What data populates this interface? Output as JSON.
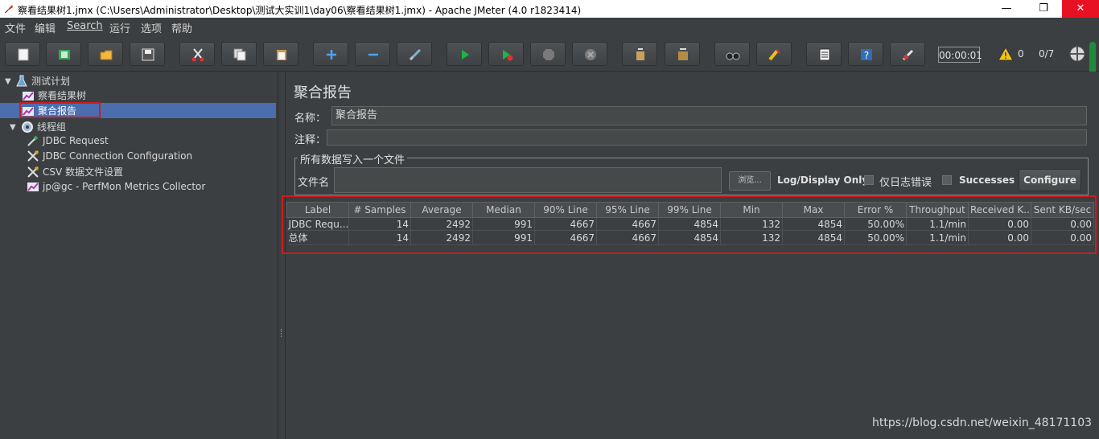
{
  "window": {
    "title": "察看结果树1.jmx (C:\\Users\\Administrator\\Desktop\\测试大实训1\\day06\\察看结果树1.jmx) - Apache JMeter (4.0 r1823414)",
    "minimize": "—",
    "maximize": "❐",
    "close": "✕"
  },
  "menu": [
    "文件",
    "编辑",
    "Search",
    "运行",
    "选项",
    "帮助"
  ],
  "toolbar": {
    "icons": [
      "new-icon",
      "templates-icon",
      "open-icon",
      "save-icon",
      "cut-icon",
      "copy-icon",
      "paste-icon",
      "expand-icon",
      "collapse-icon",
      "toggle-icon",
      "start-icon",
      "start-no-pause-icon",
      "stop-icon",
      "shutdown-icon",
      "clear-icon",
      "clear-all-icon",
      "search-icon",
      "reset-search-icon",
      "function-helper-icon",
      "help-icon",
      "remote-icon"
    ],
    "timer": "00:00:01",
    "warnings": "0",
    "threads": "0/7"
  },
  "tree": {
    "nodes": [
      {
        "label": "测试计划",
        "icon": "flask-icon"
      },
      {
        "label": "察看结果树",
        "icon": "chart-icon"
      },
      {
        "label": "聚合报告",
        "icon": "chart-icon"
      },
      {
        "label": "线程组",
        "icon": "gear-icon"
      },
      {
        "label": "JDBC Request",
        "icon": "pipette-icon"
      },
      {
        "label": "JDBC Connection Configuration",
        "icon": "wrench-icon"
      },
      {
        "label": "CSV 数据文件设置",
        "icon": "wrench-icon"
      },
      {
        "label": "jp@gc - PerfMon Metrics Collector",
        "icon": "chart-icon"
      }
    ]
  },
  "panel": {
    "title": "聚合报告",
    "name_label": "名称：",
    "name_value": "聚合报告",
    "comment_label": "注释：",
    "comment_value": "",
    "file_group_title": "所有数据写入一个文件",
    "filename_label": "文件名",
    "filename_value": "",
    "browse_label": "浏览...",
    "log_display_label": "Log/Display Only:",
    "errors_only_label": "仅日志错误",
    "successes_label": "Successes",
    "configure_label": "Configure"
  },
  "table": {
    "columns": [
      "Label",
      "# Samples",
      "Average",
      "Median",
      "90% Line",
      "95% Line",
      "99% Line",
      "Min",
      "Max",
      "Error %",
      "Throughput",
      "Received K...",
      "Sent KB/sec"
    ],
    "rows": [
      [
        "JDBC Requ...",
        "14",
        "2492",
        "991",
        "4667",
        "4667",
        "4854",
        "132",
        "4854",
        "50.00%",
        "1.1/min",
        "0.00",
        "0.00"
      ],
      [
        "总体",
        "14",
        "2492",
        "991",
        "4667",
        "4667",
        "4854",
        "132",
        "4854",
        "50.00%",
        "1.1/min",
        "0.00",
        "0.00"
      ]
    ]
  },
  "watermark": "https://blog.csdn.net/weixin_48171103"
}
